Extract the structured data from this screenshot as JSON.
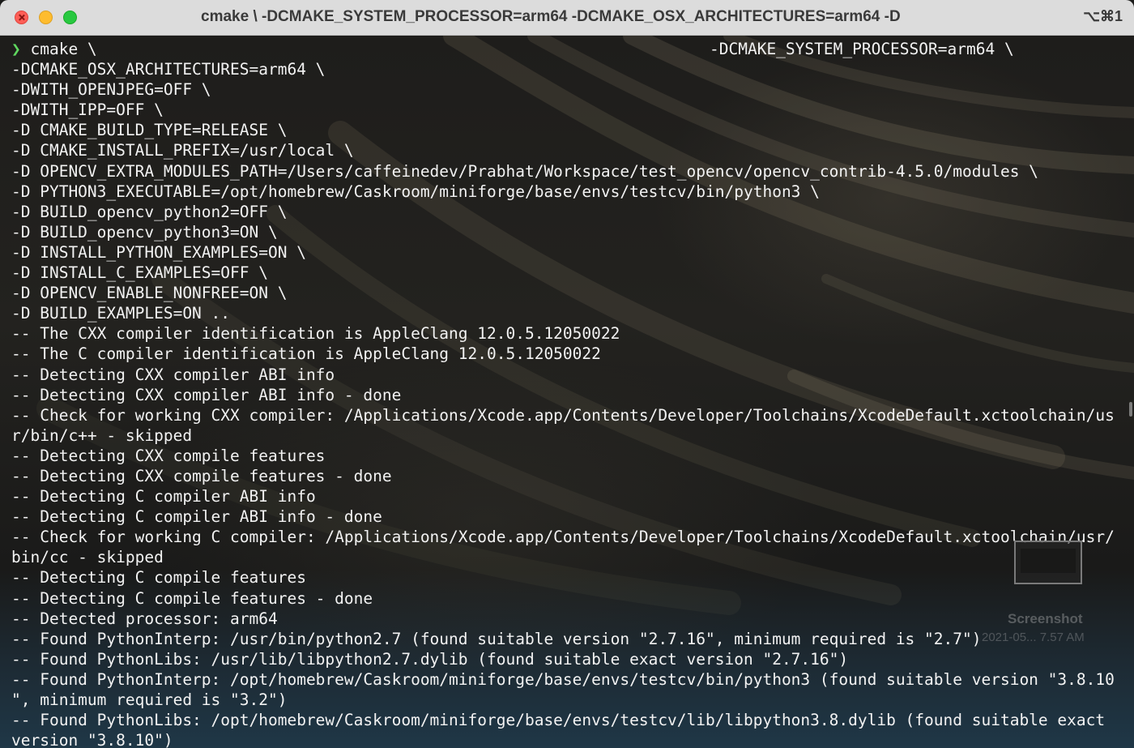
{
  "window": {
    "title": "cmake \\  -DCMAKE_SYSTEM_PROCESSOR=arm64 -DCMAKE_OSX_ARCHITECTURES=arm64  -D",
    "shortcut": "⌥⌘1"
  },
  "terminal": {
    "prompt_symbol": "❯",
    "first_line": " cmake \\",
    "first_line_right": "-DCMAKE_SYSTEM_PROCESSOR=arm64 \\",
    "lines": [
      "-DCMAKE_OSX_ARCHITECTURES=arm64 \\",
      "-DWITH_OPENJPEG=OFF \\",
      "-DWITH_IPP=OFF \\",
      "-D CMAKE_BUILD_TYPE=RELEASE \\",
      "-D CMAKE_INSTALL_PREFIX=/usr/local \\",
      "-D OPENCV_EXTRA_MODULES_PATH=/Users/caffeinedev/Prabhat/Workspace/test_opencv/opencv_contrib-4.5.0/modules \\",
      "-D PYTHON3_EXECUTABLE=/opt/homebrew/Caskroom/miniforge/base/envs/testcv/bin/python3 \\",
      "-D BUILD_opencv_python2=OFF \\",
      "-D BUILD_opencv_python3=ON \\",
      "-D INSTALL_PYTHON_EXAMPLES=ON \\",
      "-D INSTALL_C_EXAMPLES=OFF \\",
      "-D OPENCV_ENABLE_NONFREE=ON \\",
      "-D BUILD_EXAMPLES=ON ..",
      "-- The CXX compiler identification is AppleClang 12.0.5.12050022",
      "-- The C compiler identification is AppleClang 12.0.5.12050022",
      "-- Detecting CXX compiler ABI info",
      "-- Detecting CXX compiler ABI info - done",
      "-- Check for working CXX compiler: /Applications/Xcode.app/Contents/Developer/Toolchains/XcodeDefault.xctoolchain/us",
      "r/bin/c++ - skipped",
      "-- Detecting CXX compile features",
      "-- Detecting CXX compile features - done",
      "-- Detecting C compiler ABI info",
      "-- Detecting C compiler ABI info - done",
      "-- Check for working C compiler: /Applications/Xcode.app/Contents/Developer/Toolchains/XcodeDefault.xctoolchain/usr/",
      "bin/cc - skipped",
      "-- Detecting C compile features",
      "-- Detecting C compile features - done",
      "-- Detected processor: arm64",
      "-- Found PythonInterp: /usr/bin/python2.7 (found suitable version \"2.7.16\", minimum required is \"2.7\")",
      "-- Found PythonLibs: /usr/lib/libpython2.7.dylib (found suitable exact version \"2.7.16\")",
      "-- Found PythonInterp: /opt/homebrew/Caskroom/miniforge/base/envs/testcv/bin/python3 (found suitable version \"3.8.10",
      "\", minimum required is \"3.2\")",
      "-- Found PythonLibs: /opt/homebrew/Caskroom/miniforge/base/envs/testcv/lib/libpython3.8.dylib (found suitable exact",
      "version \"3.8.10\")"
    ]
  },
  "desktop_thumbnail": {
    "label": "Screenshot",
    "date": "2021-05... 7.57 AM"
  }
}
